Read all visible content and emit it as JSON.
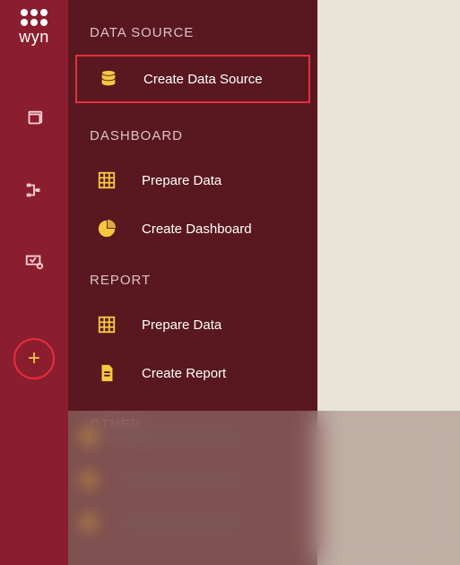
{
  "logo": {
    "text": "wyn"
  },
  "sections": {
    "data_source": {
      "header": "DATA SOURCE",
      "items": {
        "create_data_source": "Create Data Source"
      }
    },
    "dashboard": {
      "header": "DASHBOARD",
      "items": {
        "prepare_data": "Prepare Data",
        "create_dashboard": "Create Dashboard"
      }
    },
    "report": {
      "header": "REPORT",
      "items": {
        "prepare_data": "Prepare Data",
        "create_report": "Create Report"
      }
    },
    "other": {
      "header": "OTHER"
    }
  },
  "colors": {
    "accent_yellow": "#f5c842",
    "highlight_red": "#e62e3c",
    "panel_bg": "#591820",
    "rail_bg": "#8a1e2f"
  }
}
